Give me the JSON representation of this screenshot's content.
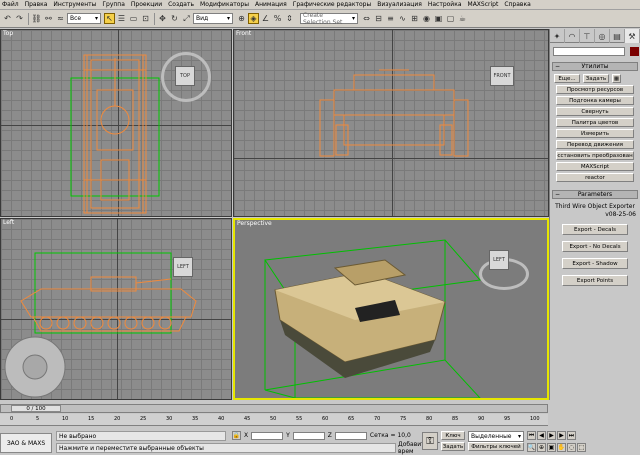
{
  "menu": [
    "Файл",
    "Правка",
    "Инструменты",
    "Группа",
    "Проекции",
    "Создать",
    "Модификаторы",
    "Анимация",
    "Графические редакторы",
    "Визуализация",
    "Настройка",
    "MAXScript",
    "Справка"
  ],
  "toolbar": {
    "filter": "Все",
    "view": "Вид",
    "named_set": "Create Selection Set"
  },
  "viewports": {
    "top": "Top",
    "front": "Front",
    "left": "Left",
    "perspective": "Perspective"
  },
  "viewcubes": {
    "top": "TOP",
    "front": "FRONT",
    "left": "LEFT",
    "persp": "LEFT"
  },
  "panel": {
    "utilities_header": "Утилиты",
    "more_button": "Еще...",
    "sets_button": "Задать",
    "utilities": [
      "Просмотр ресурсов",
      "Подгонка камеры",
      "Свернуть",
      "Палитра цветов",
      "Измерить",
      "Перевод движения",
      "Восстановить преобразование",
      "MAXScript",
      "reactor"
    ],
    "params_header": "Parameters",
    "exporter_name": "Third Wire Object Exporter",
    "exporter_version": "v08-25-06",
    "exports": [
      "Export - Decals",
      "Export - No Decals",
      "Export - Shadow",
      "Export Points"
    ]
  },
  "timeline": {
    "frame": "0 / 100",
    "ticks": [
      "0",
      "5",
      "10",
      "15",
      "20",
      "25",
      "30",
      "35",
      "40",
      "45",
      "50",
      "55",
      "60",
      "65",
      "70",
      "75",
      "80",
      "85",
      "90",
      "95",
      "100"
    ]
  },
  "status": {
    "selection": "Не выбрано",
    "prompt": "Нажмите и переместите выбранные объекты",
    "x_label": "X",
    "y_label": "Y",
    "z_label": "Z",
    "grid": "Сетка = 10,0",
    "add_key": "Добавить тэг врем",
    "key_mode": "Ключ",
    "set_key": "Задать",
    "selected": "Выделенные",
    "key_filters": "Фильтры ключей",
    "app": "ЗАО & MAXS"
  },
  "colors": {
    "wire": "#f08a3c",
    "persp_border": "#e6e600",
    "bg": "#8c8c8c"
  }
}
